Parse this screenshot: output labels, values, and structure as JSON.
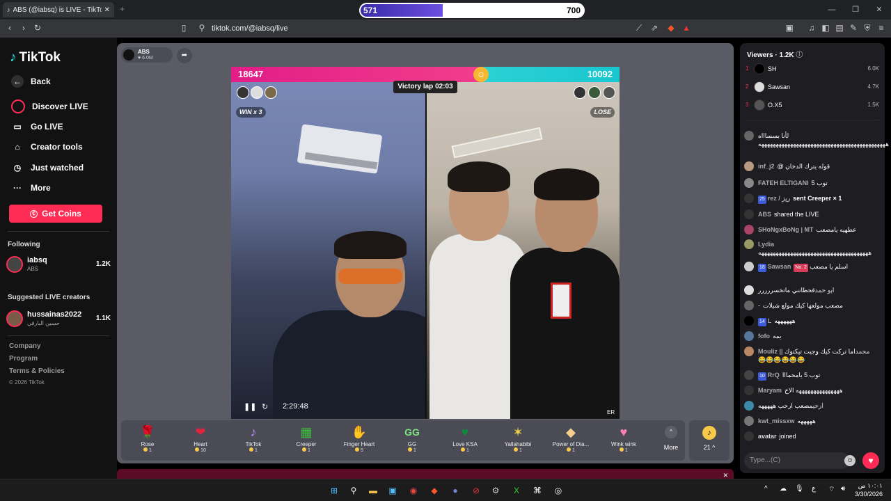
{
  "browser": {
    "tab_title": "ABS (@iabsq) is LIVE - TikTok",
    "url": "tiktok.com/@iabsq/live",
    "subscribers": {
      "label": "SUBSCRIBERS",
      "left": "571",
      "right": "700",
      "progress": 0.37
    }
  },
  "sidebar": {
    "logo": "TikTok",
    "nav": [
      {
        "label": "Back",
        "icon": "back-arrow-icon"
      },
      {
        "label": "Discover LIVE",
        "icon": "live-icon"
      },
      {
        "label": "Go LIVE",
        "icon": "camera-icon"
      },
      {
        "label": "Creator tools",
        "icon": "home-icon"
      },
      {
        "label": "Just watched",
        "icon": "history-icon"
      },
      {
        "label": "More",
        "icon": "ellipsis-icon"
      }
    ],
    "get_coins": "Get Coins",
    "following_heading": "Following",
    "following": {
      "name": "iabsq",
      "sub": "ABS",
      "count": "1.2K"
    },
    "suggested_heading": "Suggested LIVE creators",
    "suggested": {
      "name": "hussainas2022",
      "sub": "حسين البارقي",
      "count": "1.1K"
    },
    "footer": [
      "Company",
      "Program",
      "Terms & Policies",
      "© 2026 TikTok"
    ]
  },
  "host": {
    "name": "ABS",
    "likes": "♥ 6.0M"
  },
  "battle": {
    "left_score": "18647",
    "right_score": "10092",
    "left_share": 0.649,
    "victory": "Victory lap 02:03",
    "left_label": "WIN x 3",
    "right_label": "LOSE"
  },
  "video": {
    "time": "2:29:48",
    "er": "ER"
  },
  "gifts": [
    {
      "name": "Rose",
      "price": "1",
      "icon": "🌹"
    },
    {
      "name": "Heart",
      "price": "10",
      "icon": "❤"
    },
    {
      "name": "TikTok",
      "price": "1",
      "icon": "♪"
    },
    {
      "name": "Creeper",
      "price": "1",
      "icon": "▦"
    },
    {
      "name": "Finger Heart",
      "price": "5",
      "icon": "✋"
    },
    {
      "name": "GG",
      "price": "1",
      "icon": "GG"
    },
    {
      "name": "Love KSA",
      "price": "1",
      "icon": "♥"
    },
    {
      "name": "Yallahabibi",
      "price": "1",
      "icon": "✶"
    },
    {
      "name": "Power of Dia...",
      "price": "1",
      "icon": "◆"
    },
    {
      "name": "Wink wink",
      "price": "1",
      "icon": "♥"
    }
  ],
  "more_label": "More",
  "coins_balance": "21",
  "viewers": {
    "heading": "Viewers · 1.2K",
    "top": [
      {
        "rank": "1",
        "name": "SH",
        "score": "6.0K"
      },
      {
        "rank": "2",
        "name": "Sawsan",
        "score": "4.7K"
      },
      {
        "rank": "3",
        "name": "O.X5",
        "score": "1.5K"
      }
    ]
  },
  "chat": [
    {
      "user": "ل",
      "text": "أنا بسساااه ههههههههههههههههههههههههههههههههههههههههههههه"
    },
    {
      "user": "inf_j2",
      "text": "@ قوله يترك الدخان"
    },
    {
      "user": "FATEH ELTIGANI",
      "text": "توب 5"
    },
    {
      "user": "rez / ريز",
      "text": "sent Creeper × 1",
      "badge": "25"
    },
    {
      "user": "ABS",
      "text": "shared the LIVE"
    },
    {
      "user": "SHoNgxBoNg | MT",
      "text": "عطهيه يامصعب"
    },
    {
      "user": "Lydia",
      "text": "ههههههههههههههههههههههههههههههههههههههه"
    },
    {
      "user": "Sawsan",
      "text": "اسلم يا مصعب",
      "badge": "18",
      "rank_badge": "No. 2"
    },
    {
      "user": "ابو حمد",
      "text": "قحطانني ماتخسررررر"
    },
    {
      "user": "-",
      "text": "مصعب مولعها كيك مولع شيلات"
    },
    {
      "user": "L",
      "text": "ههههههه",
      "badge": "14"
    },
    {
      "user": "fofo",
      "text": "يمه"
    },
    {
      "user": "Mouliz || محمد",
      "text": "اما تركت كيك وجيت تيكتوك 😂😂😂😂😂😂"
    },
    {
      "user": "RrQ",
      "text": "توب 5 يامحمااا",
      "badge": "10"
    },
    {
      "user": "Maryam",
      "text": "هههههههههههههههه الاخ"
    },
    {
      "user": "ارحب",
      "text": "مصعب ارحب هههههه"
    },
    {
      "user": "kwt_missxw",
      "text": "هههههه"
    },
    {
      "user": "avatar",
      "text": "joined"
    }
  ],
  "chat_placeholder": "Type...(C)",
  "taskbar": {
    "time": "١٠:٠١ ص",
    "date": "3/30/2026"
  }
}
